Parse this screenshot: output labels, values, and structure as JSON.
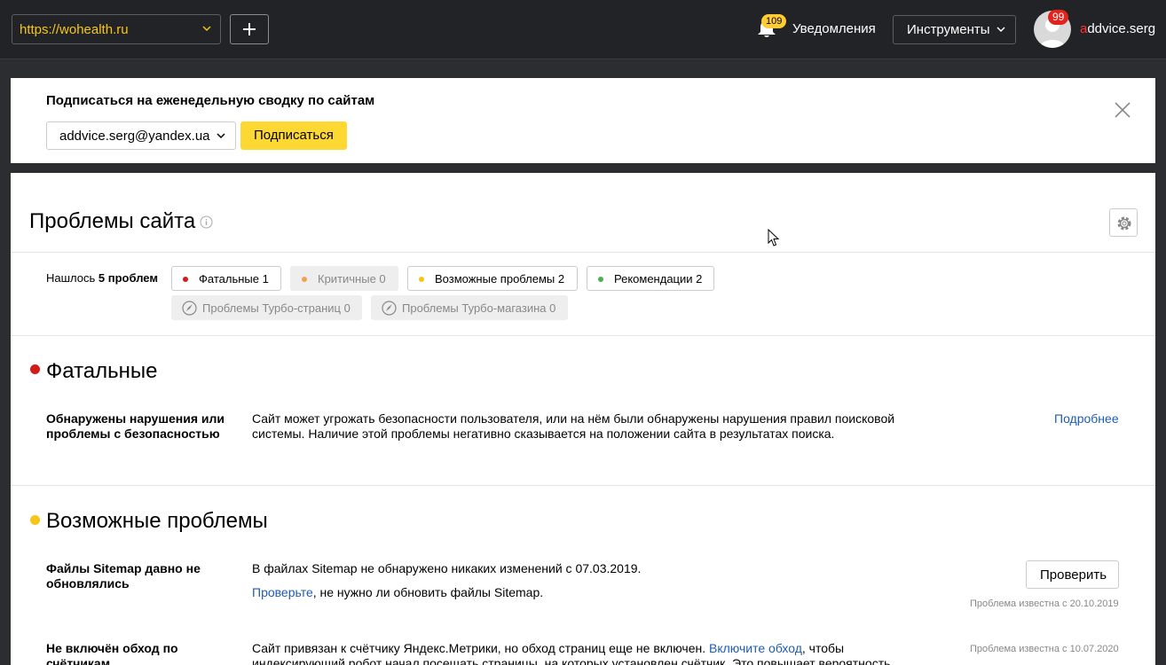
{
  "header": {
    "site_url": "https://wohealth.ru",
    "notifications_count": "109",
    "notifications_label": "Уведомления",
    "tools_label": "Инструменты",
    "avatar_badge": "99",
    "username_first": "a",
    "username_rest": "ddvice.serg"
  },
  "subscribe": {
    "title": "Подписаться на еженедельную сводку по сайтам",
    "email": "addvice.serg@yandex.ua",
    "button": "Подписаться"
  },
  "page": {
    "title": "Проблемы сайта",
    "found_prefix": "Нашлось",
    "found_count": "5 проблем",
    "filters": [
      {
        "label": "Фатальные 1",
        "color": "#d21b1b"
      },
      {
        "label": "Критичные 0",
        "color": "#f5a04e"
      },
      {
        "label": "Возможные проблемы 2",
        "color": "#f5c518"
      },
      {
        "label": "Рекомендации 2",
        "color": "#4caf50"
      }
    ],
    "turbo_filters": [
      {
        "label": "Проблемы Турбо-страниц 0"
      },
      {
        "label": "Проблемы Турбо-магазина 0"
      }
    ]
  },
  "fatal": {
    "title": "Фатальные",
    "color": "#d21b1b",
    "problem_name": "Обнаружены нарушения или проблемы с безопасностью",
    "problem_desc": "Сайт может угрожать безопасности пользователя, или на нём были обнаружены нарушения правил поисковой системы. Наличие этой проблемы негативно сказывается на положении сайта в результатах поиска.",
    "more_link": "Подробнее"
  },
  "possible": {
    "title": "Возможные проблемы",
    "color": "#f5c518",
    "sitemap": {
      "name": "Файлы Sitemap давно не обновлялись",
      "desc": "В файлах Sitemap не обнаружено никаких изменений с 07.03.2019.",
      "link": "Проверьте",
      "desc2": ", не нужно ли обновить файлы Sitemap.",
      "button": "Проверить",
      "known": "Проблема известна с 20.10.2019"
    },
    "counters": {
      "name": "Не включён обход по счётчикам",
      "desc_a": "Сайт привязан к счётчику Яндекс.Метрики, но обход страниц еще не включен. ",
      "link": "Включите обход",
      "desc_b": ", чтобы",
      "desc_line2": "индексирующий робот начал посещать страницы, на которых установлен счётчик. Это повышает вероятность",
      "known": "Проблема известна с 10.07.2020"
    }
  }
}
